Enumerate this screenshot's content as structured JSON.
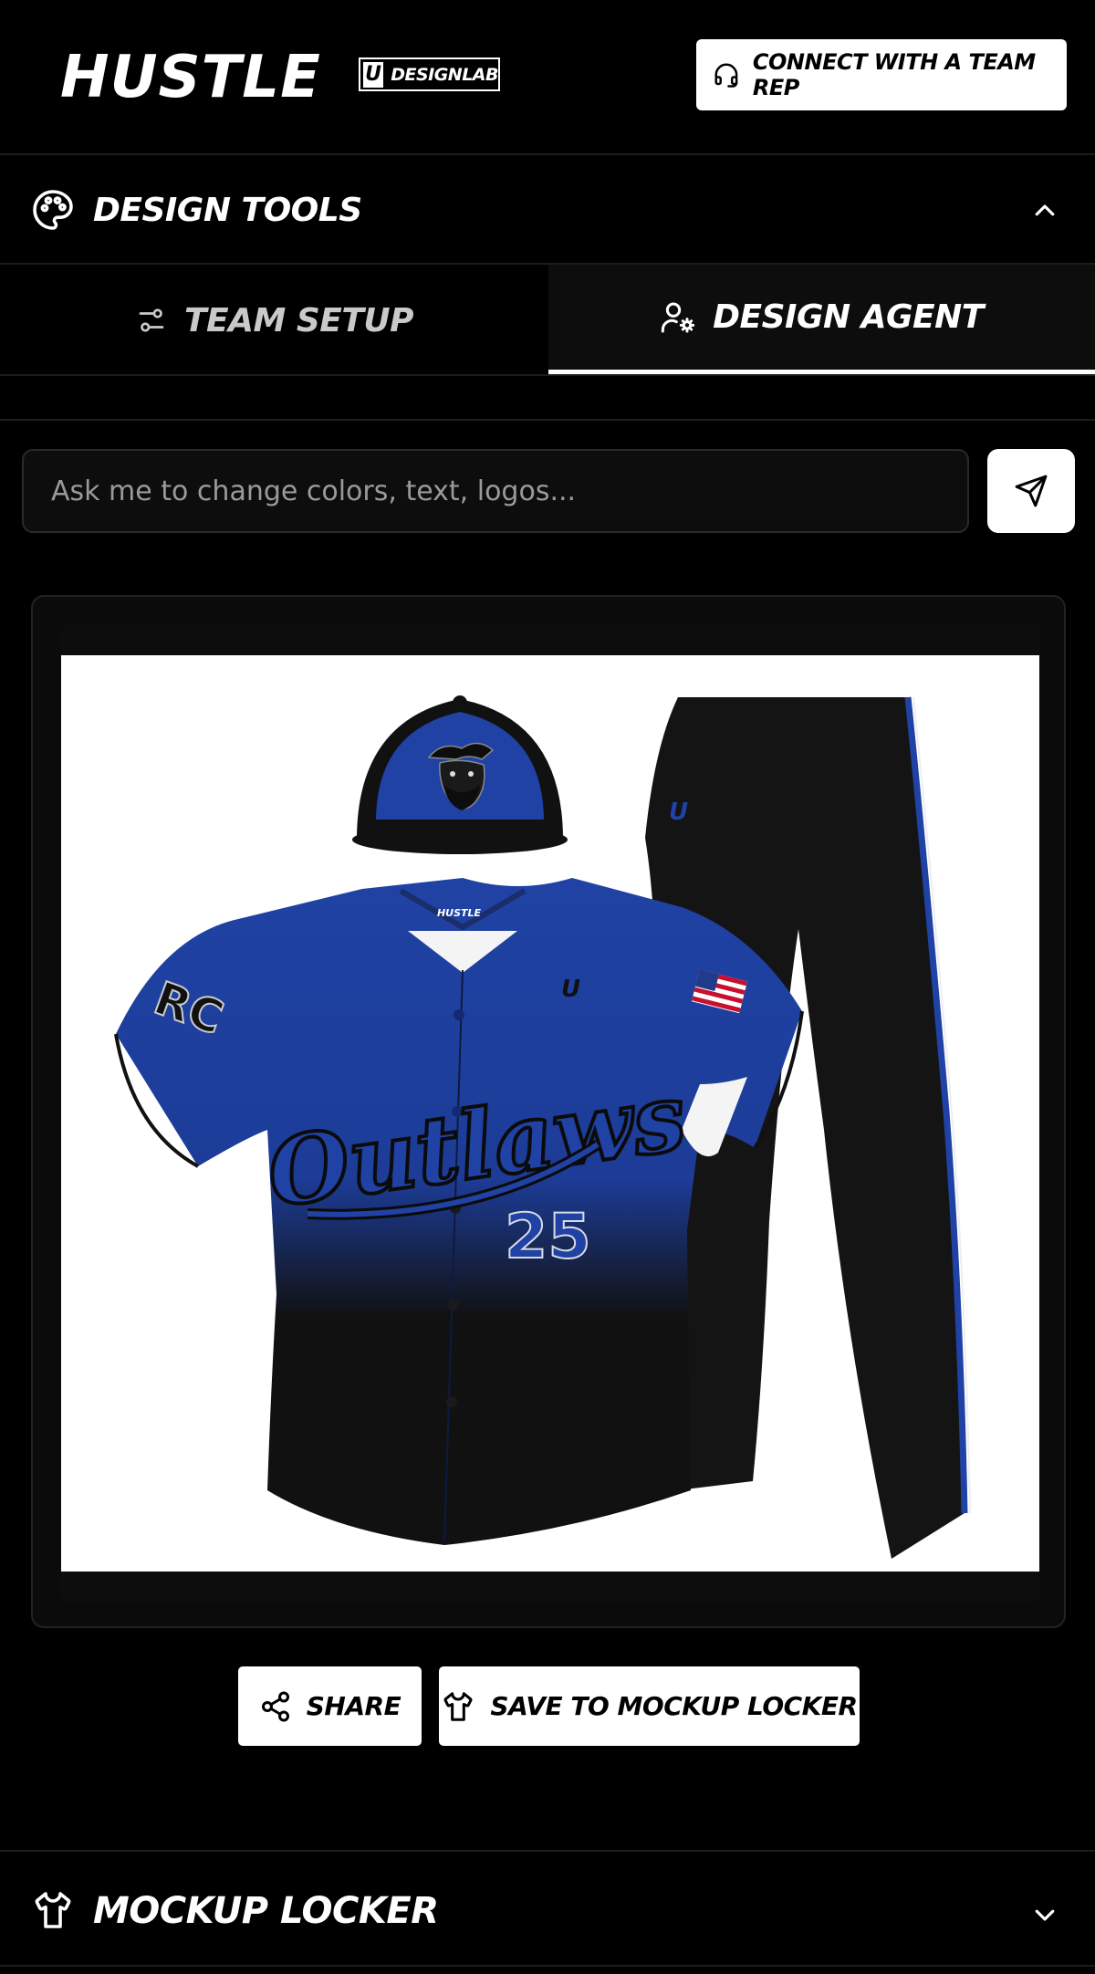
{
  "header": {
    "brand": "HUSTLE",
    "sub_brand_mark": "U",
    "sub_brand": "DESIGNLAB",
    "rep_button": "CONNECT WITH A TEAM REP",
    "rep_icon": "headset-icon"
  },
  "design_tools": {
    "title": "DESIGN TOOLS",
    "icon": "palette-icon",
    "expanded": true
  },
  "tabs": [
    {
      "label": "TEAM SETUP",
      "icon": "sliders-icon",
      "active": false
    },
    {
      "label": "DESIGN AGENT",
      "icon": "user-gear-icon",
      "active": true
    }
  ],
  "prompt": {
    "placeholder": "Ask me to change colors, text, logos...",
    "value": ""
  },
  "mockup": {
    "jersey_script": "Outlaws",
    "jersey_number": "25",
    "jersey_tag": "HUSTLE",
    "colors": {
      "primary": "#1f42a4",
      "secondary": "#111111",
      "background": "#000000"
    }
  },
  "actions": {
    "share": "SHARE",
    "save": "SAVE TO MOCKUP LOCKER"
  },
  "locker": {
    "title": "MOCKUP LOCKER",
    "expanded": false
  }
}
